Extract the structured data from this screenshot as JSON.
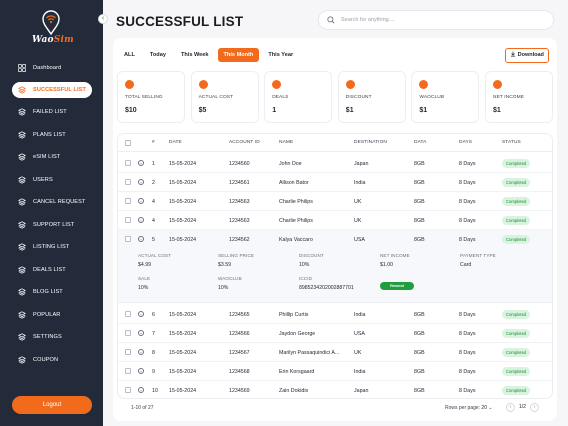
{
  "brand": {
    "logo_text_1": "Wao",
    "logo_text_2": "Sim",
    "accent": "#f26b1d",
    "sidebar_bg": "#232b3b"
  },
  "sidebar": {
    "items": [
      {
        "label": "Dashboard",
        "icon": "grid-icon",
        "active": false
      },
      {
        "label": "SUCCESSFUL LIST",
        "icon": "layers-icon",
        "active": true
      },
      {
        "label": "FAILED LIST",
        "icon": "layers-icon",
        "active": false
      },
      {
        "label": "PLANS LIST",
        "icon": "layers-icon",
        "active": false
      },
      {
        "label": "eSIM LIST",
        "icon": "layers-icon",
        "active": false
      },
      {
        "label": "USERS",
        "icon": "layers-icon",
        "active": false
      },
      {
        "label": "CANCEL REQUEST",
        "icon": "layers-icon",
        "active": false
      },
      {
        "label": "SUPPORT LIST",
        "icon": "layers-icon",
        "active": false
      },
      {
        "label": "LISTING LIST",
        "icon": "layers-icon",
        "active": false
      },
      {
        "label": "DEALS LIST",
        "icon": "layers-icon",
        "active": false
      },
      {
        "label": "BLOG LIST",
        "icon": "layers-icon",
        "active": false
      },
      {
        "label": "POPULAR",
        "icon": "layers-icon",
        "active": false
      },
      {
        "label": "SETTINGS",
        "icon": "layers-icon",
        "active": false
      },
      {
        "label": "COUPON",
        "icon": "layers-icon",
        "active": false
      }
    ],
    "logout_label": "Logout",
    "collapse_icon": "chevron-left-icon"
  },
  "header": {
    "title": "SUCCESSFUL LIST",
    "search_placeholder": "Search for anything...."
  },
  "filters": {
    "items": [
      "ALL",
      "Today",
      "This Week",
      "This Month",
      "This Year"
    ],
    "active": "This Month",
    "download_label": "Download"
  },
  "stats": [
    {
      "label": "TOTAL SELLING",
      "value": "$10"
    },
    {
      "label": "ACTUAL COST",
      "value": "$5"
    },
    {
      "label": "DEALS",
      "value": "1"
    },
    {
      "label": "DISCOUNT",
      "value": "$1"
    },
    {
      "label": "WAOCLUB",
      "value": "$1"
    },
    {
      "label": "NET INCOME",
      "value": "$1"
    }
  ],
  "table": {
    "columns": [
      "#",
      "DATE",
      "ACCOUNT ID",
      "NAME",
      "DESTINATION",
      "DATA",
      "DAYS",
      "STATUS"
    ],
    "rows": [
      {
        "num": "1",
        "date": "15-05-2024",
        "account": "1234560",
        "name": "John Doe",
        "dest": "Japan",
        "data": "8GB",
        "days": "8 Days",
        "status": "Completed"
      },
      {
        "num": "2",
        "date": "15-05-2024",
        "account": "1234561",
        "name": "Allison Bator",
        "dest": "India",
        "data": "8GB",
        "days": "8 Days",
        "status": "Completed"
      },
      {
        "num": "4",
        "date": "15-05-2024",
        "account": "1234563",
        "name": "Charlie Philips",
        "dest": "UK",
        "data": "8GB",
        "days": "8 Days",
        "status": "Completed"
      },
      {
        "num": "4",
        "date": "15-05-2024",
        "account": "1234563",
        "name": "Charlie Philips",
        "dest": "UK",
        "data": "8GB",
        "days": "8 Days",
        "status": "Completed"
      },
      {
        "num": "5",
        "date": "15-05-2024",
        "account": "1234562",
        "name": "Kalya Vaccaro",
        "dest": "USA",
        "data": "8GB",
        "days": "8 Days",
        "status": "Completed"
      },
      {
        "num": "6",
        "date": "15-05-2024",
        "account": "1234565",
        "name": "Phillip Curtis",
        "dest": "India",
        "data": "8GB",
        "days": "8 Days",
        "status": "Completed"
      },
      {
        "num": "7",
        "date": "15-05-2024",
        "account": "1234566",
        "name": "Jaydon George",
        "dest": "USA",
        "data": "8GB",
        "days": "8 Days",
        "status": "Completed"
      },
      {
        "num": "8",
        "date": "15-05-2024",
        "account": "1234567",
        "name": "Marilyn Passaquindici A...",
        "dest": "UK",
        "data": "8GB",
        "days": "8 Days",
        "status": "Completed"
      },
      {
        "num": "9",
        "date": "15-05-2024",
        "account": "1234568",
        "name": "Erin Korsgaard",
        "dest": "India",
        "data": "8GB",
        "days": "8 Days",
        "status": "Completed"
      },
      {
        "num": "10",
        "date": "15-05-2024",
        "account": "1234569",
        "name": "Zain Dokidis",
        "dest": "Japan",
        "data": "8GB",
        "days": "8 Days",
        "status": "Completed"
      }
    ],
    "detail": {
      "actual_cost_label": "ACTUAL COST",
      "actual_cost": "$4.99",
      "selling_price_label": "SELLING PRICE",
      "selling_price": "$3.59",
      "discount_label": "DISCOUNT",
      "discount": "10%",
      "net_income_label": "NET INCOME",
      "net_income": "$1.00",
      "payment_type_label": "PAYMENT TYPE",
      "payment_type": "Card",
      "sale_label": "SALE",
      "sale": "10%",
      "waoclub_label": "WAOCLUB",
      "waoclub": "10%",
      "iccid_label": "ICCID",
      "iccid": "8985234202002887701",
      "resend_label": "Resend"
    }
  },
  "footer": {
    "range": "1-10 of 27",
    "rows_per_page_label": "Rows per page:",
    "rows_per_page": "20",
    "page": "1/2"
  }
}
